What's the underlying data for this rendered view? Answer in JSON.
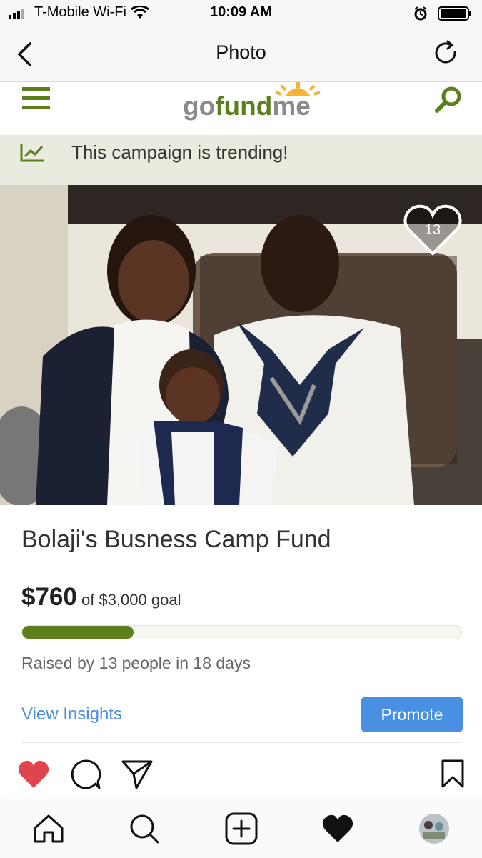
{
  "status_bar": {
    "carrier": "T-Mobile Wi-Fi",
    "time": "10:09 AM"
  },
  "nav": {
    "title": "Photo"
  },
  "gofundme": {
    "logo_go": "go",
    "logo_fund": "fund",
    "logo_me": "me",
    "trending_text": "This campaign is trending!"
  },
  "photo": {
    "heart_count": "13"
  },
  "campaign": {
    "title": "Bolaji's Busness Camp Fund",
    "amount": "$760",
    "goal_text": "of $3,000 goal",
    "progress_fraction": 0.253,
    "raised_by": "Raised by 13 people in 18 days"
  },
  "actions": {
    "view_insights": "View Insights",
    "promote": "Promote"
  },
  "colors": {
    "brand_green": "#5c7f1c",
    "link_blue": "#4a90d9",
    "promote_blue": "#4a90e2",
    "like_red": "#e0444f"
  }
}
